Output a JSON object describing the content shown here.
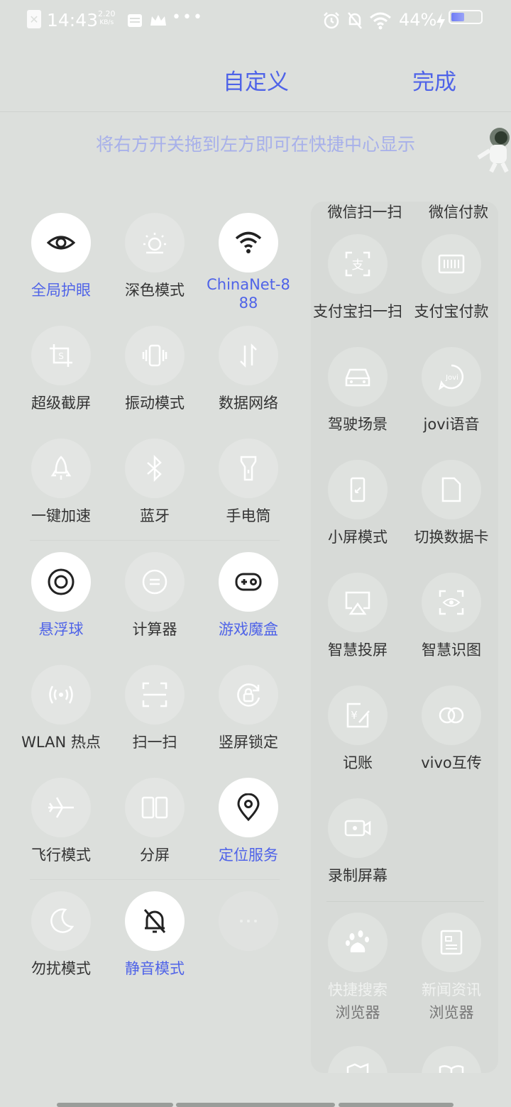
{
  "status": {
    "time": "14:43",
    "speed_value": "2.20",
    "speed_unit": "KB/s",
    "battery": "44%",
    "battery_level": 0.44
  },
  "header": {
    "title": "自定义",
    "done": "完成"
  },
  "hint": "将右方开关拖到左方即可在快捷中心显示",
  "left_tiles": [
    {
      "label": "全局护眼",
      "icon": "eye-icon",
      "active": true
    },
    {
      "label": "深色模式",
      "icon": "dark-mode-icon",
      "active": false
    },
    {
      "label": "ChinaNet-888",
      "icon": "wifi-icon",
      "active": true
    },
    {
      "label": "超级截屏",
      "icon": "screenshot-icon",
      "active": false
    },
    {
      "label": "振动模式",
      "icon": "vibration-icon",
      "active": false
    },
    {
      "label": "数据网络",
      "icon": "mobile-data-icon",
      "active": false
    },
    {
      "label": "一键加速",
      "icon": "rocket-icon",
      "active": false
    },
    {
      "label": "蓝牙",
      "icon": "bluetooth-icon",
      "active": false
    },
    {
      "label": "手电筒",
      "icon": "flashlight-icon",
      "active": false
    },
    {
      "label": "悬浮球",
      "icon": "floating-ball-icon",
      "active": true
    },
    {
      "label": "计算器",
      "icon": "calculator-icon",
      "active": false
    },
    {
      "label": "游戏魔盒",
      "icon": "gamepad-icon",
      "active": true
    },
    {
      "label": "WLAN 热点",
      "icon": "hotspot-icon",
      "active": false
    },
    {
      "label": "扫一扫",
      "icon": "scan-icon",
      "active": false
    },
    {
      "label": "竖屏锁定",
      "icon": "rotation-lock-icon",
      "active": false
    },
    {
      "label": "飞行模式",
      "icon": "airplane-icon",
      "active": false
    },
    {
      "label": "分屏",
      "icon": "split-screen-icon",
      "active": false
    },
    {
      "label": "定位服务",
      "icon": "location-icon",
      "active": true
    },
    {
      "label": "勿扰模式",
      "icon": "moon-icon",
      "active": false
    },
    {
      "label": "静音模式",
      "icon": "bell-off-icon",
      "active": true
    },
    {
      "label": "",
      "icon": "more-icon",
      "active": false
    }
  ],
  "right_tiles_partial": [
    "微信扫一扫",
    "微信付款"
  ],
  "right_tiles": [
    {
      "label": "支付宝扫一扫",
      "icon": "alipay-scan-icon"
    },
    {
      "label": "支付宝付款",
      "icon": "alipay-pay-icon"
    },
    {
      "label": "驾驶场景",
      "icon": "car-icon"
    },
    {
      "label": "jovi语音",
      "icon": "jovi-icon"
    },
    {
      "label": "小屏模式",
      "icon": "small-screen-icon"
    },
    {
      "label": "切换数据卡",
      "icon": "sim-card-icon"
    },
    {
      "label": "智慧投屏",
      "icon": "cast-screen-icon"
    },
    {
      "label": "智慧识图",
      "icon": "image-recognition-icon"
    },
    {
      "label": "记账",
      "icon": "bookkeeping-icon"
    },
    {
      "label": "vivo互传",
      "icon": "vivo-share-icon"
    },
    {
      "label": "录制屏幕",
      "icon": "screen-record-icon"
    }
  ],
  "browser_tiles": [
    {
      "label": "快捷搜索",
      "sublabel": "浏览器",
      "icon": "baidu-paw-icon"
    },
    {
      "label": "新闻资讯",
      "sublabel": "浏览器",
      "icon": "news-icon"
    }
  ],
  "colors": {
    "accent": "#4f63e8",
    "background": "#dcdfdc",
    "tile_on": "#ffffff",
    "tile_off": "#e3e5e3"
  }
}
